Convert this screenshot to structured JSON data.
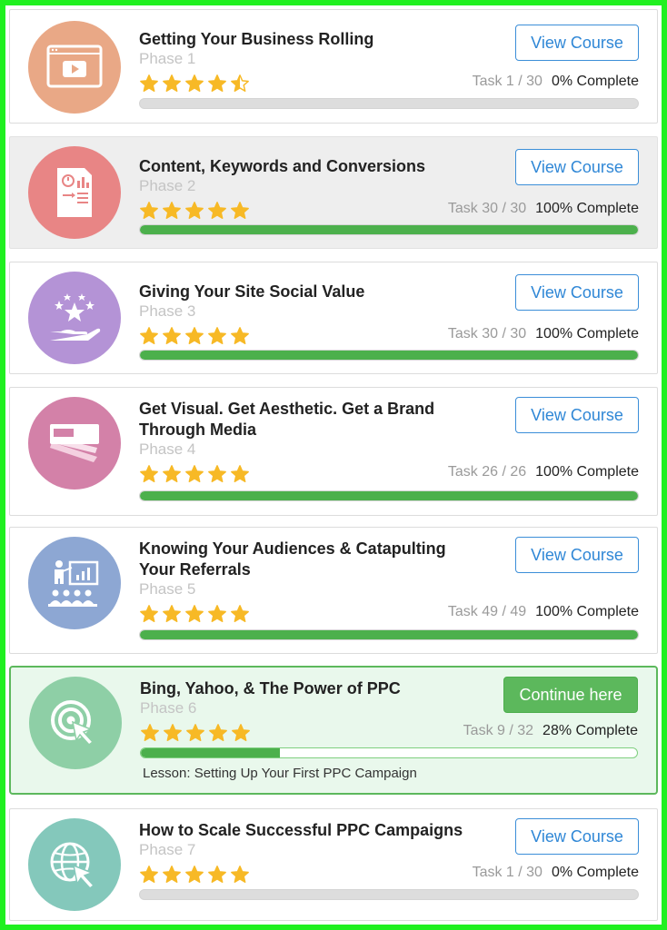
{
  "courses": [
    {
      "title": "Getting Your Business Rolling",
      "phase": "Phase 1",
      "rating": 4.5,
      "task": "Task 1 / 30",
      "complete": "0% Complete",
      "progress": 0,
      "button": "View Course",
      "icon": "video-player-icon",
      "color": "#e9a886"
    },
    {
      "title": "Content, Keywords and Conversions",
      "phase": "Phase 2",
      "rating": 5,
      "task": "Task 30 / 30",
      "complete": "100% Complete",
      "progress": 1,
      "button": "View Course",
      "icon": "report-document-icon",
      "color": "#e88585"
    },
    {
      "title": "Giving Your Site Social Value",
      "phase": "Phase 3",
      "rating": 5,
      "task": "Task 30 / 30",
      "complete": "100% Complete",
      "progress": 1,
      "button": "View Course",
      "icon": "stars-hand-icon",
      "color": "#b493d6"
    },
    {
      "title": "Get Visual. Get Aesthetic. Get a Brand Through Media",
      "phase": "Phase 4",
      "rating": 5,
      "task": "Task 26 / 26",
      "complete": "100% Complete",
      "progress": 1,
      "button": "View Course",
      "icon": "color-swatch-icon",
      "color": "#d381a8"
    },
    {
      "title": "Knowing Your Audiences & Catapulting Your Referrals",
      "phase": "Phase 5",
      "rating": 5,
      "task": "Task 49 / 49",
      "complete": "100% Complete",
      "progress": 1,
      "button": "View Course",
      "icon": "presentation-audience-icon",
      "color": "#8da7d3"
    },
    {
      "title": "Bing, Yahoo, & The Power of PPC",
      "phase": "Phase 6",
      "rating": 5,
      "task": "Task 9 / 32",
      "complete": "28% Complete",
      "progress": 0.28,
      "button": "Continue here",
      "lesson": "Lesson: Setting Up Your First PPC Campaign",
      "icon": "target-click-icon",
      "color": "#8ecfa6"
    },
    {
      "title": "How to Scale Successful PPC Campaigns",
      "phase": "Phase 7",
      "rating": 5,
      "task": "Task 1 / 30",
      "complete": "0% Complete",
      "progress": 0,
      "button": "View Course",
      "icon": "globe-cursor-icon",
      "color": "#84c8bb"
    }
  ],
  "colors": {
    "star": "#f7b926",
    "progress": "#4cb04c",
    "link": "#2f87d6",
    "frame": "#20f020"
  }
}
